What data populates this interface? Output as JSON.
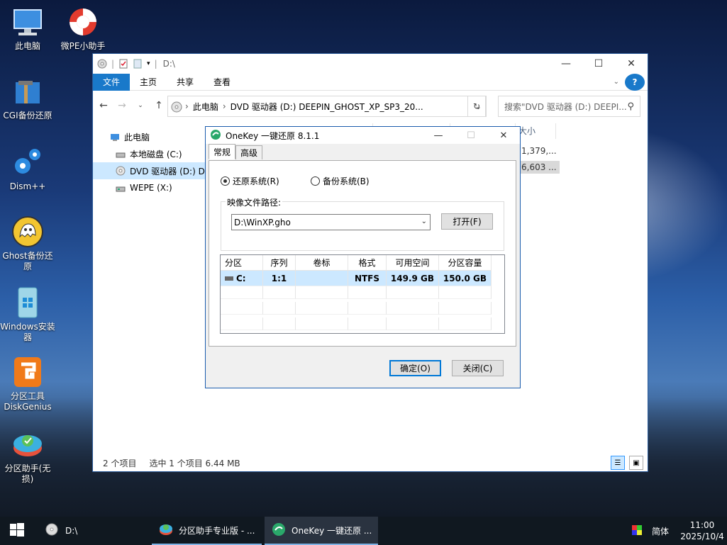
{
  "desktop": {
    "icons": [
      {
        "label": "此电脑"
      },
      {
        "label": "微PE小助手"
      },
      {
        "label": "CGI备份还原"
      },
      {
        "label": "Dism++"
      },
      {
        "label": "Ghost备份还原"
      },
      {
        "label": "Windows安装器"
      },
      {
        "label": "分区工具DiskGenius"
      },
      {
        "label": "分区助手(无损)"
      }
    ]
  },
  "explorer": {
    "title_path": "D:\\",
    "ribbon": {
      "file": "文件",
      "home": "主页",
      "share": "共享",
      "view": "查看"
    },
    "address": {
      "root": "此电脑",
      "drive": "DVD 驱动器 (D:) DEEPIN_GHOST_XP_SP3_20..."
    },
    "search_placeholder": "搜索\"DVD 驱动器 (D:) DEEPI...",
    "nav": {
      "this_pc": "此电脑",
      "local_disk": "本地磁盘 (C:)",
      "dvd": "DVD 驱动器 (D:) D",
      "wepe": "WEPE (X:)"
    },
    "column_size": "大小",
    "sizes": [
      "1,379,...",
      "6,603 ..."
    ],
    "status": {
      "count": "2 个项目",
      "selected": "选中 1 个项目  6.44 MB"
    }
  },
  "dialog": {
    "title": "OneKey 一键还原 8.1.1",
    "tabs": [
      "常规",
      "高级"
    ],
    "radio_restore": "还原系统(R)",
    "radio_backup": "备份系统(B)",
    "path_label": "映像文件路径:",
    "path_value": "D:\\WinXP.gho",
    "open_button": "打开(F)",
    "table": {
      "headers": [
        "分区",
        "序列",
        "卷标",
        "格式",
        "可用空间",
        "分区容量"
      ],
      "rows": [
        [
          "C:",
          "1:1",
          "",
          "NTFS",
          "149.9 GB",
          "150.0 GB"
        ]
      ]
    },
    "ok_button": "确定(O)",
    "close_button": "关闭(C)"
  },
  "taskbar": {
    "items": [
      {
        "label": "D:\\"
      },
      {
        "label": "分区助手专业版 - ..."
      },
      {
        "label": "OneKey 一键还原 ..."
      }
    ],
    "ime": "简体",
    "time": "11:00",
    "date": "2025/10/4"
  },
  "colors": {
    "accent": "#1979ca",
    "selection": "#cce8ff",
    "dialog_border": "#1a5cad"
  }
}
